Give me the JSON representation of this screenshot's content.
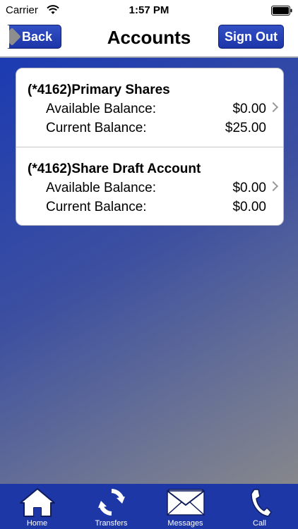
{
  "status_bar": {
    "carrier": "Carrier",
    "time": "1:57 PM"
  },
  "nav": {
    "title": "Accounts",
    "back_label": "Back",
    "signout_label": "Sign Out"
  },
  "accounts": [
    {
      "name": "(*4162)Primary Shares",
      "available_label": "Available Balance:",
      "available_value": "$0.00",
      "current_label": "Current Balance:",
      "current_value": "$25.00"
    },
    {
      "name": "(*4162)Share Draft Account",
      "available_label": "Available Balance:",
      "available_value": "$0.00",
      "current_label": "Current Balance:",
      "current_value": "$0.00"
    }
  ],
  "tabs": [
    {
      "label": "Home",
      "icon": "home-icon"
    },
    {
      "label": "Transfers",
      "icon": "refresh-icon"
    },
    {
      "label": "Messages",
      "icon": "envelope-icon"
    },
    {
      "label": "Call",
      "icon": "phone-icon"
    }
  ],
  "colors": {
    "accent": "#1e37a6",
    "tab_icon": "#ffffff"
  }
}
